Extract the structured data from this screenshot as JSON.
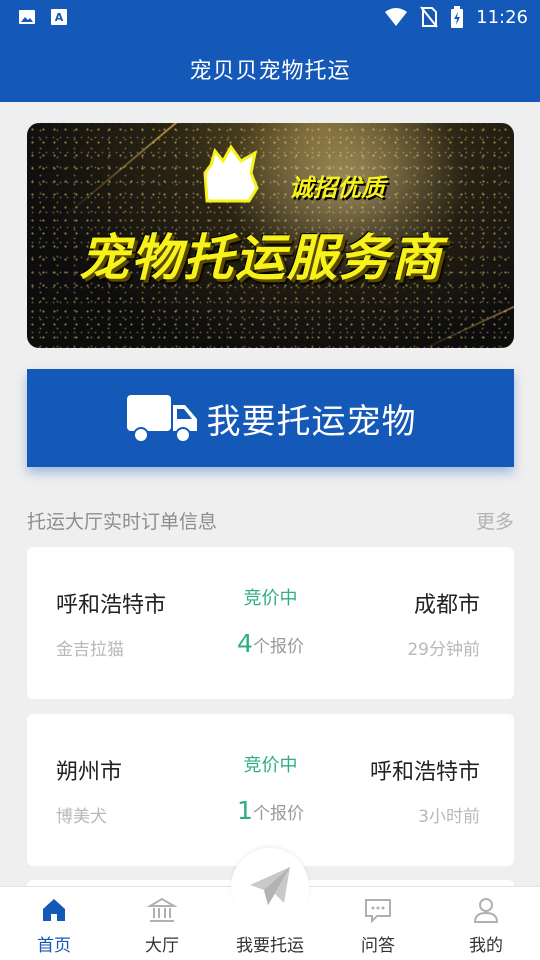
{
  "status_bar": {
    "time": "11:26",
    "icons": [
      "image-icon",
      "text-a-icon",
      "wifi-icon",
      "no-sim-icon",
      "battery-charging-icon"
    ]
  },
  "app_bar": {
    "title": "宠贝贝宠物托运"
  },
  "banner": {
    "subtitle": "诚招优质",
    "headline": "宠物托运服务商",
    "slide_count": 1,
    "active_slide": 1
  },
  "cta": {
    "label": "我要托运宠物",
    "icon": "truck-icon"
  },
  "orders_section": {
    "title": "托运大厅实时订单信息",
    "more_label": "更多",
    "orders": [
      {
        "from": "呼和浩特市",
        "to": "成都市",
        "status": "竞价中",
        "pet": "金吉拉猫",
        "quote_count": "4",
        "quote_suffix": "个报价",
        "time": "29分钟前"
      },
      {
        "from": "朔州市",
        "to": "呼和浩特市",
        "status": "竞价中",
        "pet": "博美犬",
        "quote_count": "1",
        "quote_suffix": "个报价",
        "time": "3小时前"
      }
    ]
  },
  "bottom_nav": {
    "items": [
      {
        "label": "首页",
        "icon": "home-icon",
        "active": true
      },
      {
        "label": "大厅",
        "icon": "bank-icon",
        "active": false
      },
      {
        "label": "我要托运",
        "icon": "paper-plane-icon",
        "active": false
      },
      {
        "label": "问答",
        "icon": "chat-icon",
        "active": false
      },
      {
        "label": "我的",
        "icon": "user-icon",
        "active": false
      }
    ]
  },
  "colors": {
    "primary": "#1458b8",
    "status_green": "#2fae7e",
    "banner_text": "#f7f31a",
    "background": "#efefef"
  }
}
